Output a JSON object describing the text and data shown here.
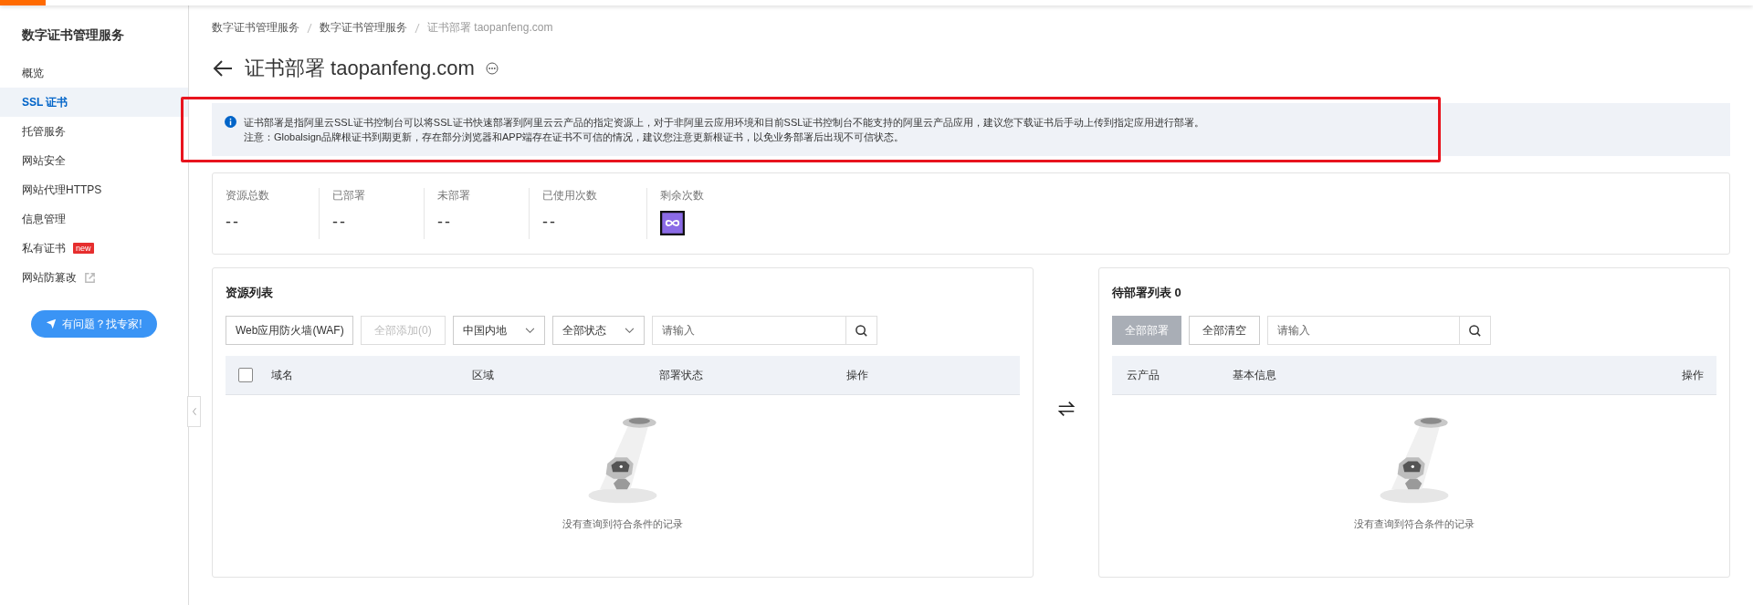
{
  "sidebar": {
    "title": "数字证书管理服务",
    "items": [
      {
        "label": "概览",
        "selected": false
      },
      {
        "label": "SSL 证书",
        "selected": true
      },
      {
        "label": "托管服务",
        "selected": false
      },
      {
        "label": "网站安全",
        "selected": false
      },
      {
        "label": "网站代理HTTPS",
        "selected": false
      },
      {
        "label": "信息管理",
        "selected": false
      },
      {
        "label": "私有证书",
        "selected": false,
        "badge": "new"
      },
      {
        "label": "网站防篡改",
        "selected": false,
        "external": true
      }
    ],
    "help_button": "有问题？找专家!"
  },
  "breadcrumb": [
    "数字证书管理服务",
    "数字证书管理服务",
    "证书部署 taopanfeng.com"
  ],
  "page_title": "证书部署 taopanfeng.com",
  "alert": {
    "lines": [
      "证书部署是指阿里云SSL证书控制台可以将SSL证书快速部署到阿里云云产品的指定资源上，对于非阿里云应用环境和目前SSL证书控制台不能支持的阿里云产品应用，建议您下载证书后手动上传到指定应用进行部署。",
      "注意：Globalsign品牌根证书到期更新，存在部分浏览器和APP端存在证书不可信的情况，建议您注意更新根证书，以免业务部署后出现不可信状态。"
    ],
    "highlighted": true
  },
  "stats": [
    {
      "label": "资源总数",
      "kind": "text",
      "value": "--"
    },
    {
      "label": "已部署",
      "kind": "text",
      "value": "--"
    },
    {
      "label": "未部署",
      "kind": "text",
      "value": "--"
    },
    {
      "label": "已使用次数",
      "kind": "text",
      "value": "--"
    },
    {
      "label": "剩余次数",
      "kind": "infinity"
    }
  ],
  "resource_list": {
    "title": "资源列表",
    "product_select": "Web应用防火墙(WAF)",
    "add_all_button": {
      "label": "全部添加(0)",
      "disabled": true
    },
    "region_select": "中国内地",
    "status_select": "全部状态",
    "search": {
      "placeholder": "请输入"
    },
    "columns": [
      "域名",
      "区域",
      "部署状态",
      "操作"
    ],
    "select_all": {
      "checked": false
    },
    "empty_text": "没有查询到符合条件的记录"
  },
  "pending_list": {
    "title": "待部署列表 0",
    "deploy_all_button": {
      "label": "全部部署",
      "disabled": true
    },
    "clear_all_button": {
      "label": "全部清空",
      "disabled": false
    },
    "search": {
      "placeholder": "请输入"
    },
    "columns": [
      "云产品",
      "基本信息",
      "操作"
    ],
    "empty_text": "没有查询到符合条件的记录"
  }
}
